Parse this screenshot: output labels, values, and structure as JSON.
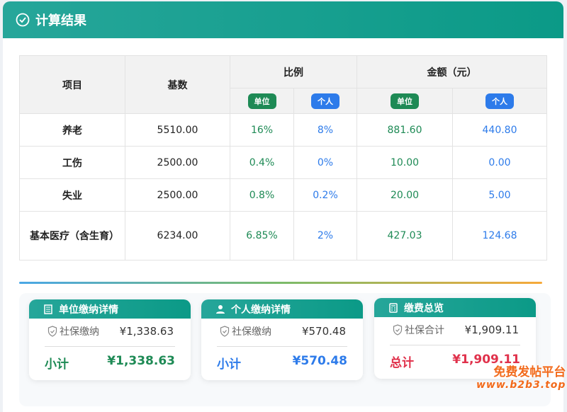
{
  "title": "计算结果",
  "table": {
    "headers": {
      "item": "项目",
      "base": "基数",
      "ratio": "比例",
      "amount": "金额（元）",
      "unit": "单位",
      "personal": "个人"
    },
    "rows": [
      {
        "item": "养老",
        "base": "5510.00",
        "ru": "16%",
        "rp": "8%",
        "au": "881.60",
        "ap": "440.80"
      },
      {
        "item": "工伤",
        "base": "2500.00",
        "ru": "0.4%",
        "rp": "0%",
        "au": "10.00",
        "ap": "0.00"
      },
      {
        "item": "失业",
        "base": "2500.00",
        "ru": "0.8%",
        "rp": "0.2%",
        "au": "20.00",
        "ap": "5.00"
      },
      {
        "item": "基本医疗（含生育）",
        "base": "6234.00",
        "ru": "6.85%",
        "rp": "2%",
        "au": "427.03",
        "ap": "124.68"
      }
    ]
  },
  "cards": [
    {
      "title": "单位缴纳详情",
      "icon": "building-icon",
      "label": "社保缴纳",
      "value": "¥1,338.63",
      "total_label": "小计",
      "total": "¥1,338.63",
      "color": "#1e8a55"
    },
    {
      "title": "个人缴纳详情",
      "icon": "user-icon",
      "label": "社保缴纳",
      "value": "¥570.48",
      "total_label": "小计",
      "total": "¥570.48",
      "color": "#2d7bea"
    },
    {
      "title": "缴费总览",
      "icon": "calculator-icon",
      "label": "社保合计",
      "value": "¥1,909.11",
      "total_label": "总计",
      "total": "¥1,909.11",
      "color": "#e0314b"
    }
  ],
  "watermark": {
    "line1": "免费发帖平台",
    "line2": "www.b2b3.top"
  },
  "colors": {
    "header": "#0b9a87",
    "unit": "#1e8a55",
    "personal": "#2d7bea",
    "total": "#e0314b"
  }
}
